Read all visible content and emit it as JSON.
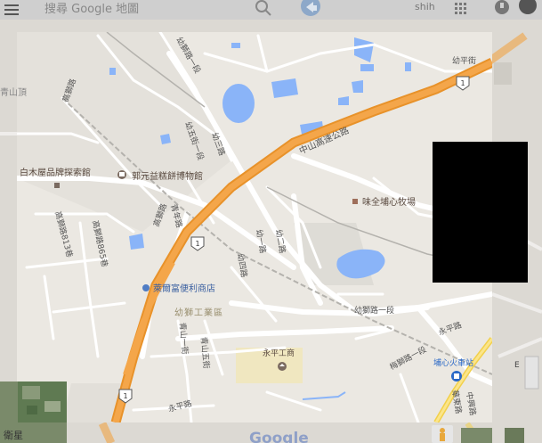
{
  "search": {
    "placeholder": "搜尋 Google 地圖"
  },
  "account": {
    "name": "shih"
  },
  "satellite_label": "衛星",
  "google_logo": "Google",
  "pois": {
    "bakery_museum": "郭元益糕餅博物館",
    "wood_house": "白木屋品牌探索館",
    "ranch": "味全埔心牧場",
    "store": "萊爾富便利商店",
    "school": "永平工商",
    "station": "埔心火車站"
  },
  "areas": {
    "industrial": "幼獅工業區",
    "hill": "青山頂"
  },
  "roads": {
    "freeway": "中山高速公路",
    "youping": "幼平街",
    "youshi1_top": "幼獅路一段",
    "youshi1_mid": "幼獅路一段",
    "youshi1_low": "梅獅路一段",
    "youwu": "幼五街一段",
    "yousan": "幼三路",
    "qingnian": "青年路",
    "gaoshi813": "高獅路813巷",
    "gaoshi865": "高獅路865巷",
    "gaoshi": "高獅路",
    "gaoshi_left": "高獅路",
    "youyi": "幼一路",
    "yousi": "幼四路",
    "youer": "幼二路",
    "qingshan5": "青山五街",
    "qingshan1": "青山一街",
    "yongping": "永平路",
    "yongping2": "永平路",
    "zhongxing": "中興路",
    "huadong": "華東路",
    "e_label": "E"
  },
  "shields": {
    "route1": "1"
  }
}
